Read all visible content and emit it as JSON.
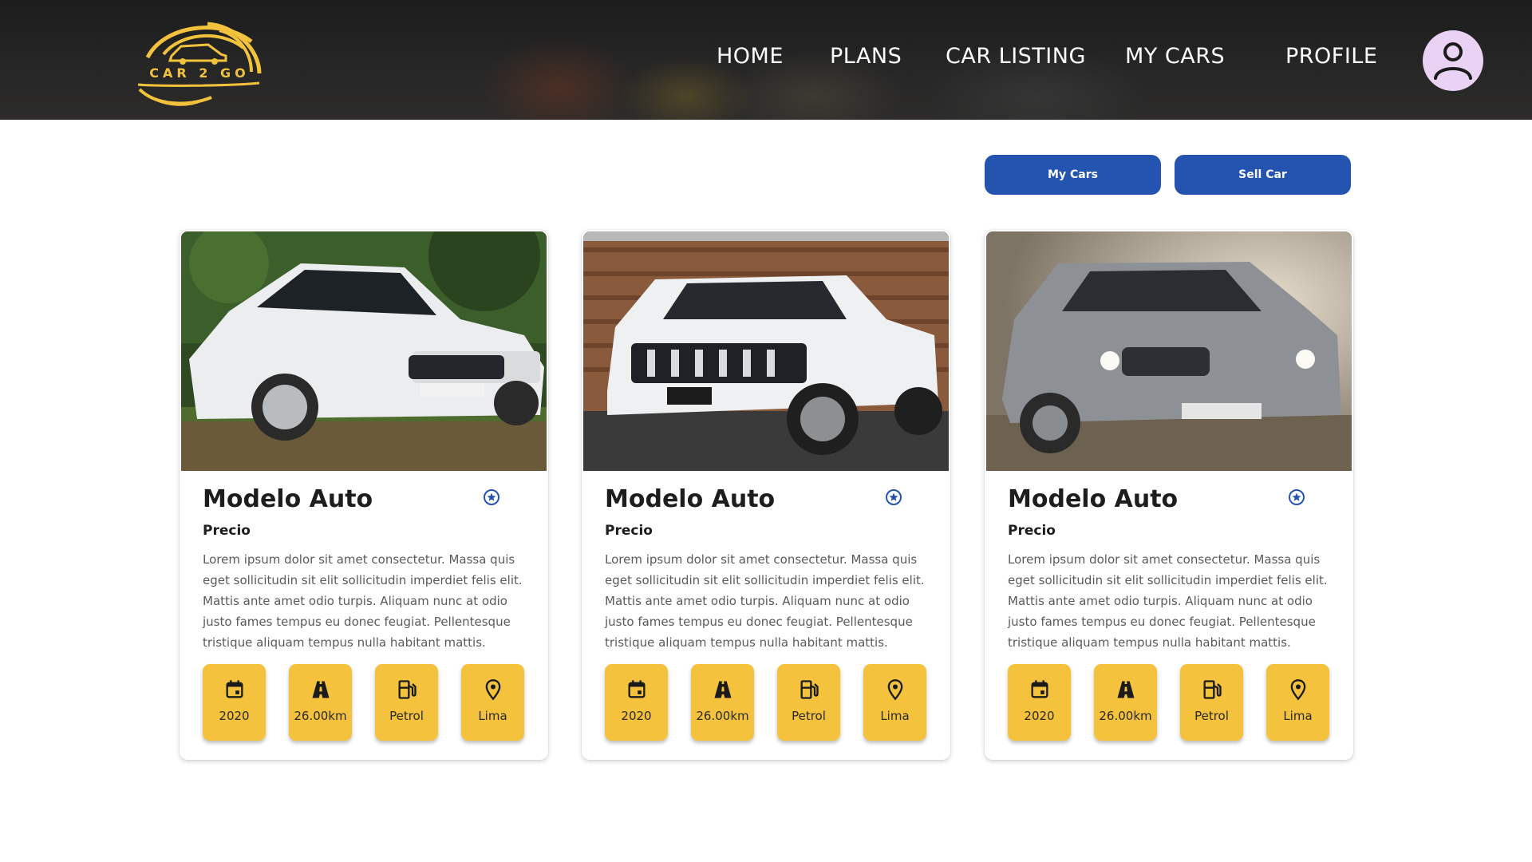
{
  "header": {
    "logo_text": "CAR 2 GO",
    "nav": [
      {
        "label": "HOME"
      },
      {
        "label": "PLANS"
      },
      {
        "label": "CAR LISTING"
      },
      {
        "label": "MY CARS"
      },
      {
        "label": "PROFILE"
      }
    ]
  },
  "actions": {
    "my_cars": "My Cars",
    "sell_car": "Sell Car"
  },
  "colors": {
    "header_bg": "#1f1f1f",
    "brand_gold": "#f3c23d",
    "button_blue": "#2453b0",
    "spec_yellow": "#f4c23c",
    "avatar_bg": "#e9d2f3",
    "favorite_icon": "#2453b0"
  },
  "cards": [
    {
      "image": "white-sedan-photo",
      "title": "Modelo Auto",
      "price": "Precio",
      "description": "Lorem ipsum dolor sit amet consectetur. Massa quis eget sollicitudin sit elit sollicitudin imperdiet felis elit. Mattis ante amet odio turpis. Aliquam nunc at odio justo fames tempus eu donec feugiat. Pellentesque tristique aliquam tempus nulla habitant mattis.",
      "specs": {
        "year": "2020",
        "mileage": "26.00km",
        "fuel": "Petrol",
        "location": "Lima"
      }
    },
    {
      "image": "white-suv-photo",
      "title": "Modelo Auto",
      "price": "Precio",
      "description": "Lorem ipsum dolor sit amet consectetur. Massa quis eget sollicitudin sit elit sollicitudin imperdiet felis elit. Mattis ante amet odio turpis. Aliquam nunc at odio justo fames tempus eu donec feugiat. Pellentesque tristique aliquam tempus nulla habitant mattis.",
      "specs": {
        "year": "2020",
        "mileage": "26.00km",
        "fuel": "Petrol",
        "location": "Lima"
      }
    },
    {
      "image": "silver-suv-photo",
      "title": "Modelo Auto",
      "price": "Precio",
      "description": "Lorem ipsum dolor sit amet consectetur. Massa quis eget sollicitudin sit elit sollicitudin imperdiet felis elit. Mattis ante amet odio turpis. Aliquam nunc at odio justo fames tempus eu donec feugiat. Pellentesque tristique aliquam tempus nulla habitant mattis.",
      "specs": {
        "year": "2020",
        "mileage": "26.00km",
        "fuel": "Petrol",
        "location": "Lima"
      }
    }
  ],
  "icons": {
    "favorite": "star-circle-icon",
    "year": "calendar-icon",
    "mileage": "road-icon",
    "fuel": "fuel-pump-icon",
    "location": "location-pin-icon",
    "avatar": "user-icon"
  }
}
